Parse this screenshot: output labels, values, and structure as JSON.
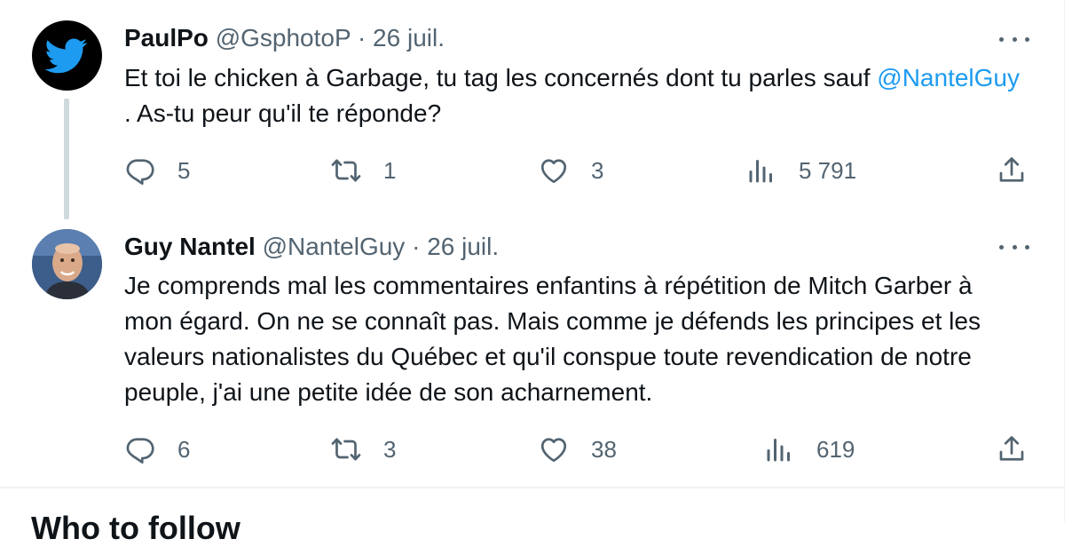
{
  "tweets": [
    {
      "name": "PaulPo",
      "handle": "@GsphotoP",
      "separator": "·",
      "date": "26 juil.",
      "text_before": "Et toi le chicken à Garbage, tu tag les concernés dont tu parles sauf ",
      "mention": "@NantelGuy",
      "text_after": " . As-tu peur qu'il te réponde?",
      "replies": "5",
      "retweets": "1",
      "likes": "3",
      "views": "5 791",
      "avatar_icon": "bird-icon"
    },
    {
      "name": "Guy Nantel",
      "handle": "@NantelGuy",
      "separator": "·",
      "date": "26 juil.",
      "text": "Je comprends mal les commentaires enfantins à répétition de Mitch Garber à mon égard. On ne se connaît pas. Mais comme je défends les principes et les valeurs nationalistes du Québec et qu'il conspue toute revendication de notre peuple, j'ai une petite idée de son acharnement.",
      "replies": "6",
      "retweets": "3",
      "likes": "38",
      "views": "619",
      "avatar_icon": "profile-photo"
    }
  ],
  "sidebar_section": {
    "title": "Who to follow"
  },
  "colors": {
    "text": "#0f1419",
    "secondary": "#536471",
    "link": "#1d9bf0",
    "thread_line": "#cfd9de",
    "bird": "#1d9bf0"
  }
}
